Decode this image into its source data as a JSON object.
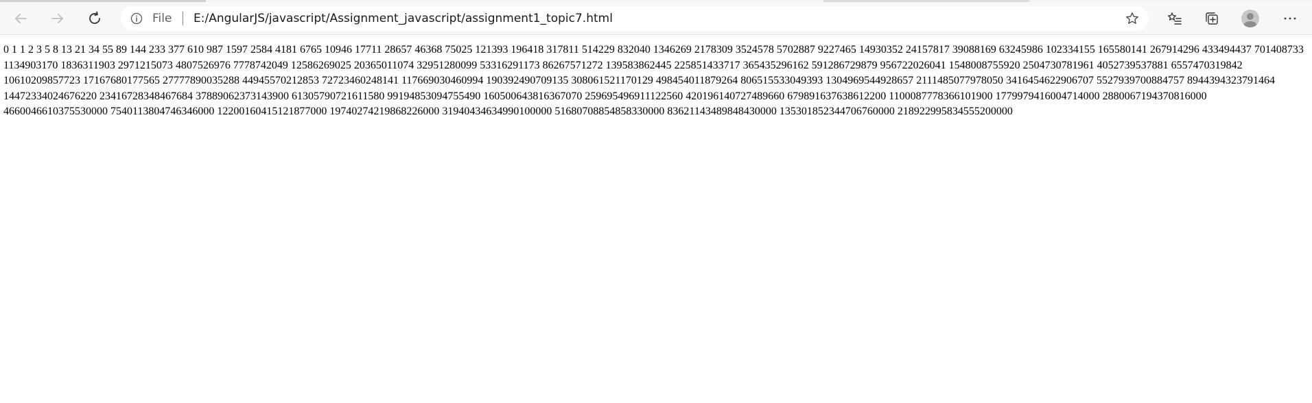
{
  "browser": {
    "address_bar": {
      "scheme_label": "File",
      "url": "E:/AngularJS/javascript/Assignment_javascript/assignment1_topic7.html"
    },
    "icons": {
      "back": "arrow-left-icon",
      "forward": "arrow-right-icon",
      "refresh": "refresh-icon",
      "info": "info-icon",
      "favorite": "star-icon",
      "favorites": "favorites-icon",
      "collections": "collections-icon",
      "profile": "avatar-icon",
      "menu": "ellipsis-icon"
    }
  },
  "page": {
    "fibonacci_text": "0 1 1 2 3 5 8 13 21 34 55 89 144 233 377 610 987 1597 2584 4181 6765 10946 17711 28657 46368 75025 121393 196418 317811 514229 832040 1346269 2178309 3524578 5702887 9227465 14930352 24157817 39088169 63245986 102334155 165580141 267914296 433494437 701408733 1134903170 1836311903 2971215073 4807526976 7778742049 12586269025 20365011074 32951280099 53316291173 86267571272 139583862445 225851433717 365435296162 591286729879 956722026041 1548008755920 2504730781961 4052739537881 6557470319842 10610209857723 17167680177565 27777890035288 44945570212853 72723460248141 117669030460994 190392490709135 308061521170129 498454011879264 806515533049393 1304969544928657 2111485077978050 3416454622906707 5527939700884757 8944394323791464 14472334024676220 23416728348467684 37889062373143900 61305790721611580 99194853094755490 160500643816367070 259695496911122560 420196140727489660 679891637638612200 1100087778366101900 1779979416004714000 2880067194370816000 4660046610375530000 7540113804746346000 12200160415121877000 19740274219868226000 31940434634990100000 51680708854858330000 83621143489848430000 135301852344706760000 218922995834555200000"
  }
}
